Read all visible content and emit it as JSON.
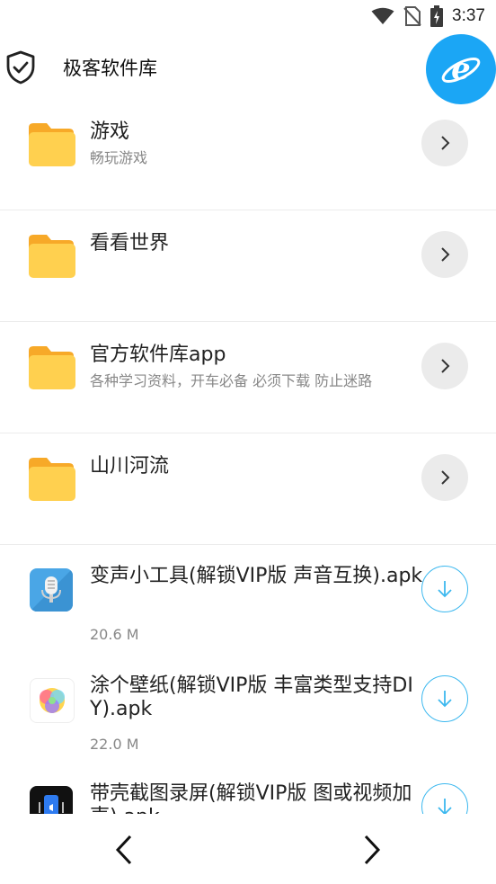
{
  "status_bar": {
    "time": "3:37",
    "icons": [
      "wifi-icon",
      "no-sim-icon",
      "battery-charging-icon"
    ]
  },
  "app_bar": {
    "title": "极客软件库",
    "left_icon": "shield-check-icon",
    "right_icon": "ie-browser-icon",
    "accent_color": "#1ba6f5"
  },
  "folders": [
    {
      "title": "游戏",
      "subtitle": "畅玩游戏"
    },
    {
      "title": "看看世界",
      "subtitle": ""
    },
    {
      "title": "官方软件库app",
      "subtitle": "各种学习资料，开车必备 必须下载 防止迷路"
    },
    {
      "title": "山川河流",
      "subtitle": ""
    }
  ],
  "files": [
    {
      "title": "变声小工具(解锁VIP版 声音互换).apk",
      "size": "20.6 M",
      "icon": "microphone-app-icon"
    },
    {
      "title": "涂个壁纸(解锁VIP版 丰富类型支持DIY).apk",
      "size": "22.0 M",
      "icon": "colorful-wallpaper-app-icon"
    },
    {
      "title": "带壳截图录屏(解锁VIP版 图或视频加壳).apk",
      "size": "",
      "icon": "screen-recorder-app-icon"
    }
  ],
  "colors": {
    "folder": "#ffd04f",
    "folder_tab": "#f7a928",
    "download_accent": "#3cb8ef",
    "arrow_button_bg": "#ebebeb"
  },
  "nav": {
    "back_icon": "chevron-left-icon",
    "forward_icon": "chevron-right-icon"
  }
}
